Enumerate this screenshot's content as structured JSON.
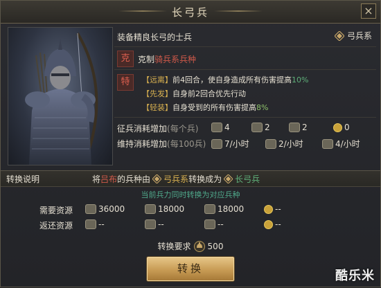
{
  "dialog": {
    "title": "长弓兵",
    "close_label": "×"
  },
  "unit": {
    "description": "装备精良长弓的士兵",
    "type_label": "弓兵系",
    "counter": {
      "badge": "克",
      "prefix": "克制",
      "target": "骑兵系兵种"
    },
    "traits_badge": "特",
    "traits": [
      {
        "tag": "【远离】",
        "text_before": "前4回合，使自身造成所有伤害提高",
        "value": "10%"
      },
      {
        "tag": "【先发】",
        "text_before": "自身前2回合优先行动",
        "value": ""
      },
      {
        "tag": "【轻装】",
        "text_before": "自身受到的所有伤害提高",
        "value": "8%"
      }
    ],
    "recruit_cost": {
      "label": "征兵消耗增加",
      "sub": "(每个兵)",
      "values": [
        {
          "icon": "wood-icon",
          "value": "4"
        },
        {
          "icon": "iron-icon",
          "value": "2"
        },
        {
          "icon": "grain-icon",
          "value": "2"
        },
        {
          "icon": "gold-icon",
          "value": "0"
        }
      ]
    },
    "upkeep_cost": {
      "label": "维持消耗增加",
      "sub": "(每100兵)",
      "values": [
        {
          "icon": "wood-icon",
          "value": "7/小时"
        },
        {
          "icon": "iron-icon",
          "value": "2/小时"
        },
        {
          "icon": "grain-icon",
          "value": "4/小时"
        }
      ]
    }
  },
  "conversion": {
    "title": "转换说明",
    "text_prefix": "将",
    "hero_name": "吕布",
    "text_middle": "的兵种由",
    "from_type": "弓兵系",
    "text_to": "转换成为",
    "to_type": "长弓兵",
    "note": "当前兵力同时转换为对应兵种",
    "need_label": "需要资源",
    "need_values": [
      {
        "icon": "wood-icon",
        "value": "36000"
      },
      {
        "icon": "iron-icon",
        "value": "18000"
      },
      {
        "icon": "grain-icon",
        "value": "18000"
      },
      {
        "icon": "gold-icon",
        "value": "--"
      }
    ],
    "return_label": "返还资源",
    "return_values": [
      {
        "icon": "wood-icon",
        "value": "--"
      },
      {
        "icon": "iron-icon",
        "value": "--"
      },
      {
        "icon": "grain-icon",
        "value": "--"
      },
      {
        "icon": "gold-icon",
        "value": "--"
      }
    ],
    "requirement_label": "转换要求",
    "requirement_value": "500",
    "button_label": "转换"
  },
  "watermark": "酷乐米",
  "colors": {
    "highlight_red": "#d25a4a",
    "highlight_green": "#5fb07a",
    "tag_gold": "#d8b050",
    "button_gold": "#c79b54"
  }
}
